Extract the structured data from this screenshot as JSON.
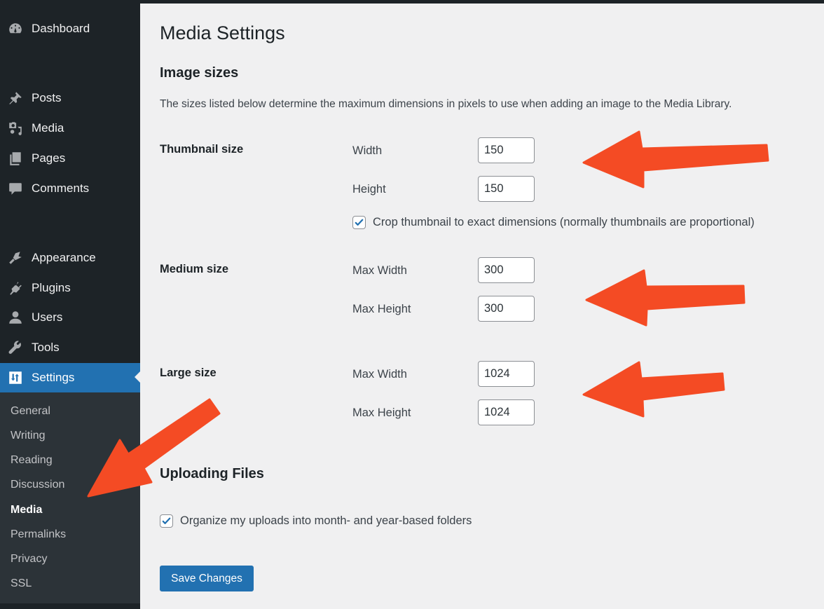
{
  "sidebar": {
    "items": [
      {
        "label": "Dashboard",
        "icon": "dashboard-icon"
      },
      {
        "label": "Posts",
        "icon": "pin-icon"
      },
      {
        "label": "Media",
        "icon": "media-icon"
      },
      {
        "label": "Pages",
        "icon": "pages-icon"
      },
      {
        "label": "Comments",
        "icon": "comment-icon"
      },
      {
        "label": "Appearance",
        "icon": "paintbrush-icon"
      },
      {
        "label": "Plugins",
        "icon": "plugin-icon"
      },
      {
        "label": "Users",
        "icon": "user-icon"
      },
      {
        "label": "Tools",
        "icon": "wrench-icon"
      },
      {
        "label": "Settings",
        "icon": "settings-icon",
        "active": true
      }
    ],
    "submenu": [
      {
        "label": "General"
      },
      {
        "label": "Writing"
      },
      {
        "label": "Reading"
      },
      {
        "label": "Discussion"
      },
      {
        "label": "Media",
        "current": true
      },
      {
        "label": "Permalinks"
      },
      {
        "label": "Privacy"
      },
      {
        "label": "SSL"
      }
    ]
  },
  "page": {
    "title": "Media Settings",
    "image_sizes": {
      "heading": "Image sizes",
      "description": "The sizes listed below determine the maximum dimensions in pixels to use when adding an image to the Media Library.",
      "thumbnail": {
        "label": "Thumbnail size",
        "width_label": "Width",
        "width_value": "150",
        "height_label": "Height",
        "height_value": "150",
        "crop_label": "Crop thumbnail to exact dimensions (normally thumbnails are proportional)",
        "crop_checked": true
      },
      "medium": {
        "label": "Medium size",
        "width_label": "Max Width",
        "width_value": "300",
        "height_label": "Max Height",
        "height_value": "300"
      },
      "large": {
        "label": "Large size",
        "width_label": "Max Width",
        "width_value": "1024",
        "height_label": "Max Height",
        "height_value": "1024"
      }
    },
    "uploading": {
      "heading": "Uploading Files",
      "organize_label": "Organize my uploads into month- and year-based folders",
      "organize_checked": true
    },
    "save_label": "Save Changes"
  },
  "colors": {
    "sidebar_bg": "#1d2327",
    "submenu_bg": "#2c3338",
    "accent": "#2271b1",
    "annotation_arrow": "#f44b24",
    "page_bg": "#f0f0f1"
  }
}
